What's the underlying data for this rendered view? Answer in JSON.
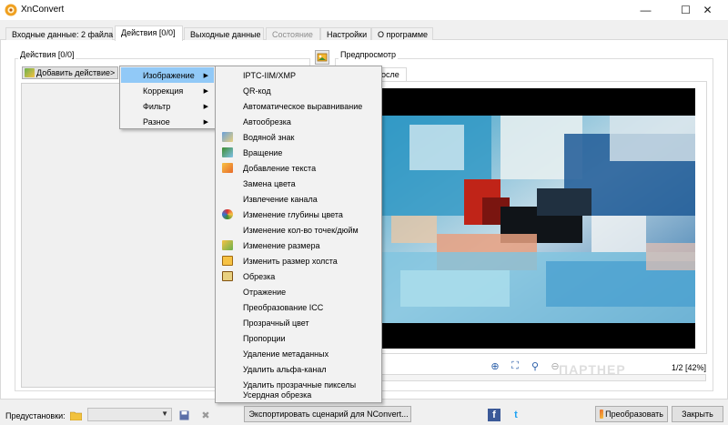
{
  "window": {
    "title": "XnConvert",
    "minimize_glyph": "—",
    "maximize_glyph": "☐",
    "close_glyph": "✕"
  },
  "tabs": [
    {
      "label": "Входные данные: 2 файла",
      "state": "normal"
    },
    {
      "label": "Действия [0/0]",
      "state": "active"
    },
    {
      "label": "Выходные данные",
      "state": "normal"
    },
    {
      "label": "Состояние",
      "state": "disabled"
    },
    {
      "label": "Настройки",
      "state": "normal"
    },
    {
      "label": "О программе",
      "state": "normal"
    }
  ],
  "actions_panel": {
    "group_label": "Действия [0/0]",
    "add_button_label": "Добавить действие>"
  },
  "preview_panel": {
    "group_label": "Предпросмотр",
    "tab_label": "осле",
    "page_info": "1/2 [42%]",
    "watermark": "ПАРТНЕР"
  },
  "main_menu": {
    "items": [
      {
        "label": "Изображение",
        "highlighted": true,
        "has_submenu": true
      },
      {
        "label": "Коррекция",
        "highlighted": false,
        "has_submenu": true
      },
      {
        "label": "Фильтр",
        "highlighted": false,
        "has_submenu": true
      },
      {
        "label": "Разное",
        "highlighted": false,
        "has_submenu": true
      }
    ],
    "submenu_arrow": "▶"
  },
  "image_submenu": {
    "items": [
      {
        "label": "IPTC-IIM/XMP",
        "icon": ""
      },
      {
        "label": "QR-код",
        "icon": ""
      },
      {
        "label": "Автоматическое выравнивание",
        "icon": ""
      },
      {
        "label": "Автообрезка",
        "icon": ""
      },
      {
        "label": "Водяной знак",
        "icon": "watermark-icon"
      },
      {
        "label": "Вращение",
        "icon": "rotate-icon"
      },
      {
        "label": "Добавление текста",
        "icon": "text-icon"
      },
      {
        "label": "Замена цвета",
        "icon": ""
      },
      {
        "label": "Извлечение канала",
        "icon": ""
      },
      {
        "label": "Изменение глубины цвета",
        "icon": "palette-icon"
      },
      {
        "label": "Изменение кол-во точек/дюйм",
        "icon": ""
      },
      {
        "label": "Изменение размера",
        "icon": "resize-icon"
      },
      {
        "label": "Изменить размер холста",
        "icon": "canvas-icon"
      },
      {
        "label": "Обрезка",
        "icon": "crop-icon"
      },
      {
        "label": "Отражение",
        "icon": ""
      },
      {
        "label": "Преобразование ICC",
        "icon": ""
      },
      {
        "label": "Прозрачный цвет",
        "icon": ""
      },
      {
        "label": "Пропорции",
        "icon": ""
      },
      {
        "label": "Удаление метаданных",
        "icon": ""
      },
      {
        "label": "Удалить альфа-канал",
        "icon": ""
      },
      {
        "label": "Удалить прозрачные пикселы",
        "icon": ""
      },
      {
        "label": "Усердная обрезка",
        "icon": ""
      }
    ]
  },
  "bottom_bar": {
    "presets_label": "Предустановки:",
    "preset_value": "",
    "export_button_label": "Экспортировать сценарий для NConvert...",
    "convert_button_label": "Преобразовать",
    "close_button_label": "Закрыть",
    "combo_arrow": "▼",
    "facebook_glyph": "f",
    "twitter_glyph": "t",
    "delete_glyph": "✖"
  },
  "colors": {
    "menu_highlight": "#91c9f7",
    "window_bg": "#f0f0f0",
    "facebook": "#3b5998",
    "twitter": "#1da1f2"
  }
}
